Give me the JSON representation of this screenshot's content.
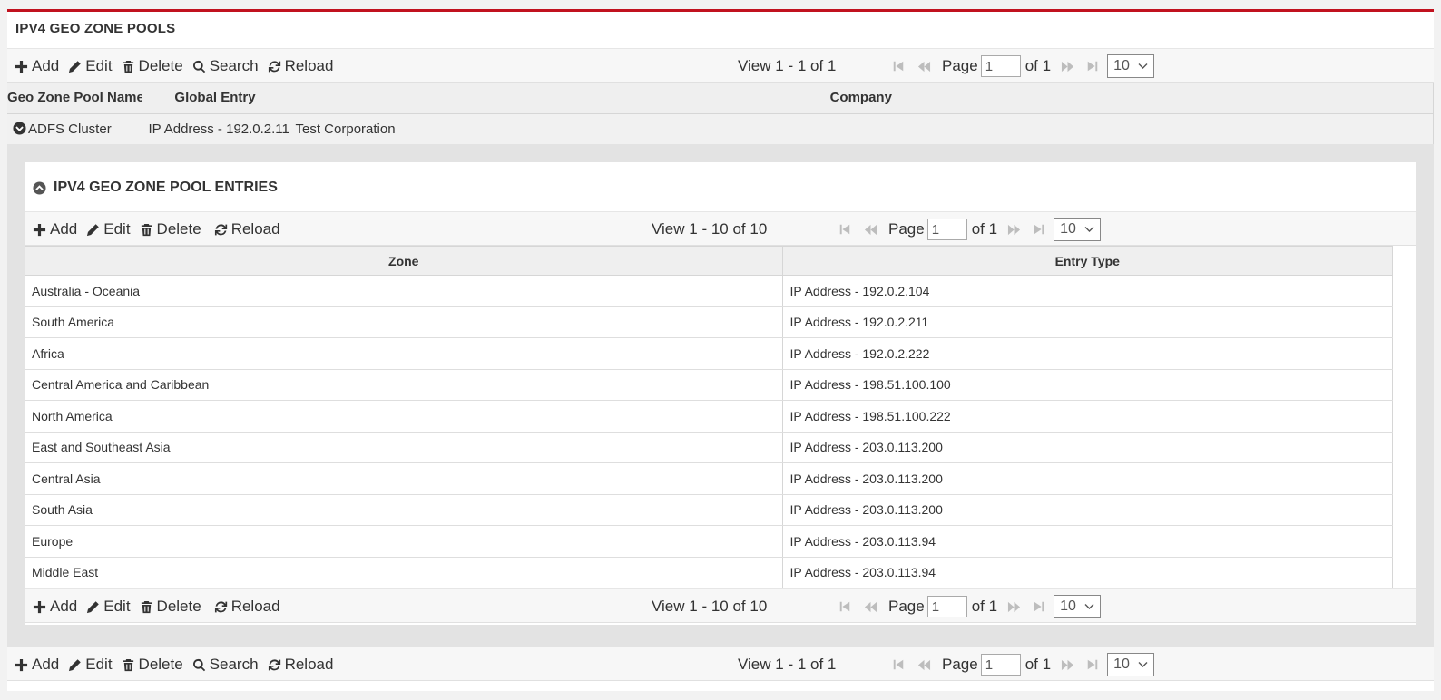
{
  "pools": {
    "caption": "IPV4 GEO ZONE POOLS",
    "toolbar": {
      "add": "Add",
      "edit": "Edit",
      "delete": "Delete",
      "search": "Search",
      "reload": "Reload"
    },
    "view_info": "View 1 - 1 of 1",
    "pager": {
      "page_label": "Page",
      "page_value": "1",
      "of_label": "of 1",
      "rows": "10"
    },
    "columns": [
      "Geo Zone Pool Name",
      "Global Entry",
      "Company"
    ],
    "rows": [
      {
        "name": "ADFS Cluster",
        "global_entry": "IP Address - 192.0.2.11",
        "company": "Test Corporation"
      }
    ]
  },
  "entries": {
    "caption": "IPV4 GEO ZONE POOL ENTRIES",
    "toolbar": {
      "add": "Add",
      "edit": "Edit",
      "delete": "Delete",
      "reload": "Reload"
    },
    "view_info": "View 1 - 10 of 10",
    "pager": {
      "page_label": "Page",
      "page_value": "1",
      "of_label": "of 1",
      "rows": "10"
    },
    "columns": [
      "Zone",
      "Entry Type"
    ],
    "rows": [
      {
        "zone": "Australia - Oceania",
        "entry_type": "IP Address - 192.0.2.104"
      },
      {
        "zone": "South America",
        "entry_type": "IP Address - 192.0.2.211"
      },
      {
        "zone": "Africa",
        "entry_type": "IP Address - 192.0.2.222"
      },
      {
        "zone": "Central America and Caribbean",
        "entry_type": "IP Address - 198.51.100.100"
      },
      {
        "zone": "North America",
        "entry_type": "IP Address - 198.51.100.222"
      },
      {
        "zone": "East and Southeast Asia",
        "entry_type": "IP Address - 203.0.113.200"
      },
      {
        "zone": "Central Asia",
        "entry_type": "IP Address - 203.0.113.200"
      },
      {
        "zone": "South Asia",
        "entry_type": "IP Address - 203.0.113.200"
      },
      {
        "zone": "Europe",
        "entry_type": "IP Address - 203.0.113.94"
      },
      {
        "zone": "Middle East",
        "entry_type": "IP Address - 203.0.113.94"
      }
    ]
  },
  "colors": {
    "accent_border": "#c1121f",
    "toolbar_bg": "#f7f7f7",
    "subgrid_bg": "#e3e3e3"
  },
  "icons": [
    "plus-icon",
    "pencil-icon",
    "trash-icon",
    "search-icon",
    "reload-icon",
    "first-page-icon",
    "prev-page-icon",
    "next-page-icon",
    "last-page-icon",
    "expand-icon",
    "collapse-icon",
    "dropdown-chevron-icon"
  ]
}
